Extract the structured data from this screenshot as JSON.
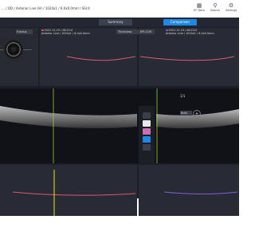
{
  "header": {
    "breadcrumb": "... / OD / Anterior Line (H) / 1024x1 / 6.0x0.0mm / SSI:4",
    "icons": [
      {
        "name": "report-icon",
        "label": "EF Data"
      },
      {
        "name": "search-icon",
        "label": "Search"
      },
      {
        "name": "settings-icon",
        "label": "Settings"
      }
    ]
  },
  "tabs": {
    "summary": "Summary",
    "comparison": "Comparison"
  },
  "fundus": {
    "mode_label": "Fundus"
  },
  "scan_a": {
    "date": "2021.11.19 / 08:21:0",
    "protocol": "Anterior Line / 1024x1 / 6.0x0.0mm",
    "layer_label": "Thickness",
    "layer_select": "EPI-CUR"
  },
  "scan_b": {
    "date": "2021.11.19 / 08:23:0",
    "protocol": "Anterior Line / 1024x1 / 6.0x0.0mm"
  },
  "viewer": {
    "page": "1/1",
    "zoom_select": "Both"
  },
  "colors": {
    "accent": "#1e88e5",
    "series_a": "#e05a6a",
    "series_b": "#8a5ad8",
    "marker_green": "#9acd32",
    "marker_yellow": "#e6e61e"
  },
  "chart_data": [
    {
      "type": "line",
      "name": "thickness-plot-a",
      "x": [
        0,
        0.25,
        0.5,
        0.75,
        1
      ],
      "values": [
        0.72,
        0.66,
        0.63,
        0.66,
        0.72
      ]
    },
    {
      "type": "line",
      "name": "thickness-plot-b",
      "x": [
        0,
        0.25,
        0.5,
        0.75,
        1
      ],
      "values": [
        0.72,
        0.66,
        0.63,
        0.66,
        0.72
      ]
    },
    {
      "type": "line",
      "name": "thickness-plot-bottom-a",
      "x": [
        0,
        0.25,
        0.5,
        0.75,
        1
      ],
      "values": [
        0.52,
        0.46,
        0.43,
        0.46,
        0.52
      ]
    },
    {
      "type": "line",
      "name": "thickness-plot-bottom-b",
      "x": [
        0,
        0.25,
        0.5,
        0.75,
        1
      ],
      "values": [
        0.52,
        0.46,
        0.43,
        0.46,
        0.52
      ]
    }
  ]
}
